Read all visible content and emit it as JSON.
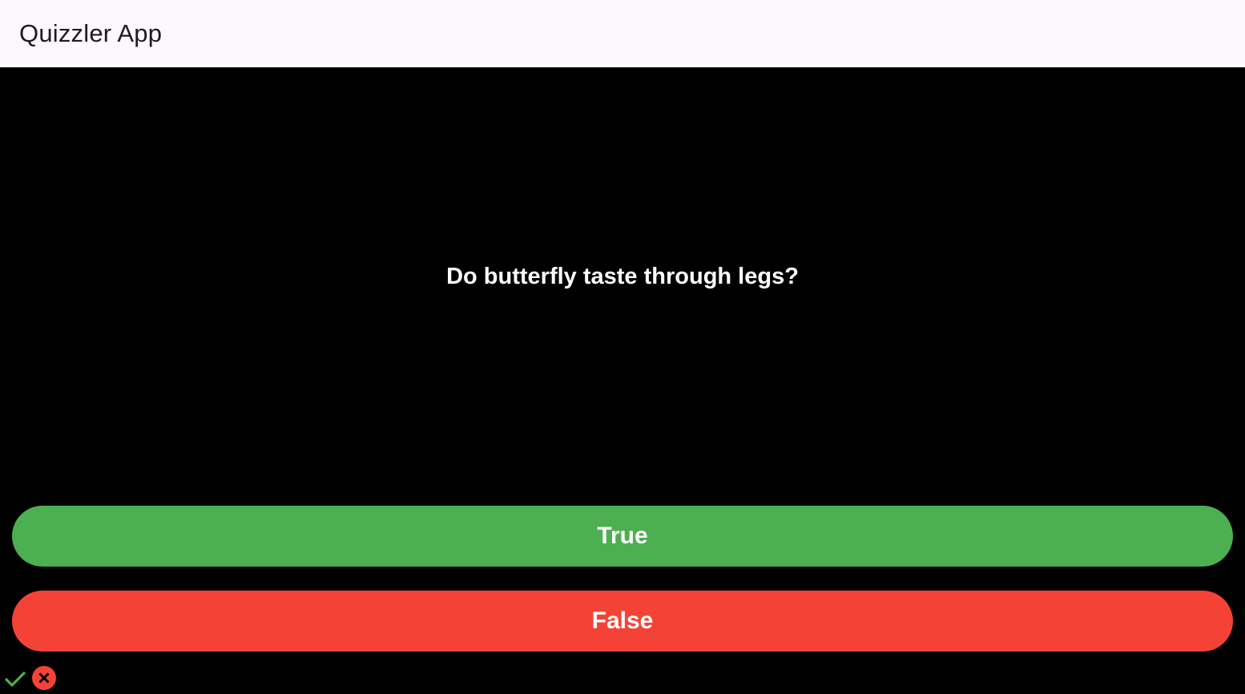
{
  "app": {
    "title": "Quizzler App"
  },
  "quiz": {
    "question": "Do butterfly taste through legs?",
    "true_label": "True",
    "false_label": "False"
  },
  "score_keeper": [
    {
      "icon": "check-icon",
      "color": "#4caf50"
    },
    {
      "icon": "cancel-icon",
      "color": "#f44336"
    }
  ],
  "colors": {
    "appbar_bg": "#fdf7fe",
    "background": "#000000",
    "true_button": "#4caf50",
    "false_button": "#f44336",
    "text": "#ffffff"
  }
}
